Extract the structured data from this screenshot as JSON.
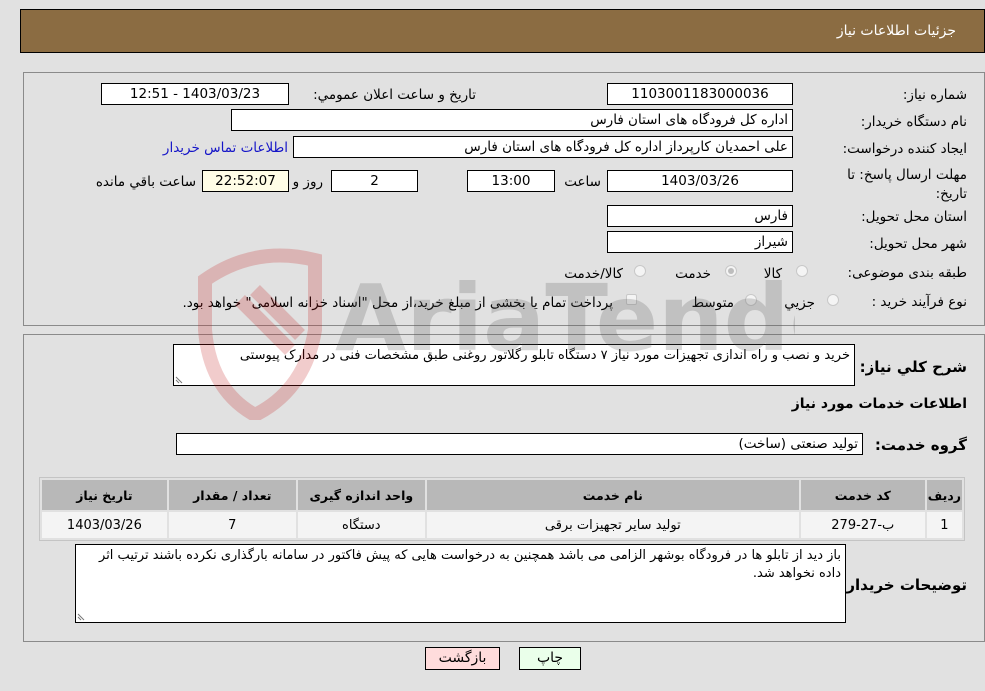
{
  "header": {
    "title": "جزئیات اطلاعات نیاز"
  },
  "form": {
    "need_number": {
      "label": "شماره نیاز:",
      "value": "1103001183000036"
    },
    "announce_datetime": {
      "label": "تاریخ و ساعت اعلان عمومي:",
      "value": "1403/03/23 - 12:51"
    },
    "buyer_org": {
      "label": "نام دستگاه خريدار:",
      "value": "اداره کل فرودگاه های استان فارس"
    },
    "requester": {
      "label": "ایجاد کننده درخواست:",
      "value": "علی  احمدیان کارپرداز اداره کل فرودگاه های استان فارس"
    },
    "contact_link": "اطلاعات تماس خریدار",
    "deadline": {
      "label": "مهلت ارسال پاسخ: تا تاریخ:",
      "date": "1403/03/26",
      "time_label": "ساعت",
      "time": "13:00",
      "days": "2",
      "days_label": "روز و",
      "remaining": "22:52:07",
      "remaining_label": "ساعت باقي مانده"
    },
    "delivery_province": {
      "label": "استان محل تحویل:",
      "value": "فارس"
    },
    "delivery_city": {
      "label": "شهر محل تحویل:",
      "value": "شیراز"
    },
    "category": {
      "label": "طبقه بندی موضوعی:",
      "options": [
        "کالا",
        "خدمت",
        "کالا/خدمت"
      ],
      "selected": "خدمت"
    },
    "process_type": {
      "label": "نوع فرآیند خرید :",
      "options": [
        "جزيي",
        "متوسط"
      ],
      "selected": "جزيي",
      "treasury_note": "پرداخت تمام یا بخشی از مبلغ خرید،از محل \"اسناد خزانه اسلامی\" خواهد بود.",
      "treasury_checked": false
    }
  },
  "description": {
    "label": "شرح كلي نياز:",
    "value": "خرید و نصب و راه اندازی تجهیزات مورد نیاز ۷ دستگاه تابلو رگلاتور روغنی طبق مشخصات فنی در مدارک پیوستی"
  },
  "services": {
    "section_title": "اطلاعات خدمات مورد نیاز",
    "group_label": "گروه خدمت:",
    "group_value": "تولید صنعتی (ساخت)",
    "columns": [
      "ردیف",
      "کد خدمت",
      "نام خدمت",
      "واحد اندازه گیری",
      "تعداد / مقدار",
      "تاریخ نیاز"
    ],
    "rows": [
      [
        "1",
        "ب-27-279",
        "تولید سایر تجهیزات برقی",
        "دستگاه",
        "7",
        "1403/03/26"
      ]
    ]
  },
  "buyer_notes": {
    "label": "توضیحات خریدار:",
    "value": "باز دید از تابلو ها در فرودگاه بوشهر الزامی می باشد همچنین به درخواست هایی که پیش فاکتور در سامانه بارگذاری نکرده باشند ترتیب اثر داده نخواهد شد."
  },
  "buttons": {
    "print": "چاپ",
    "back": "بازگشت"
  },
  "watermark": {
    "text": "AriaTender.neT"
  },
  "colors": {
    "header_bg": "#8b6c42",
    "print_btn": "#eaffea",
    "back_btn": "#ffdcdc",
    "link": "#1515c8"
  }
}
